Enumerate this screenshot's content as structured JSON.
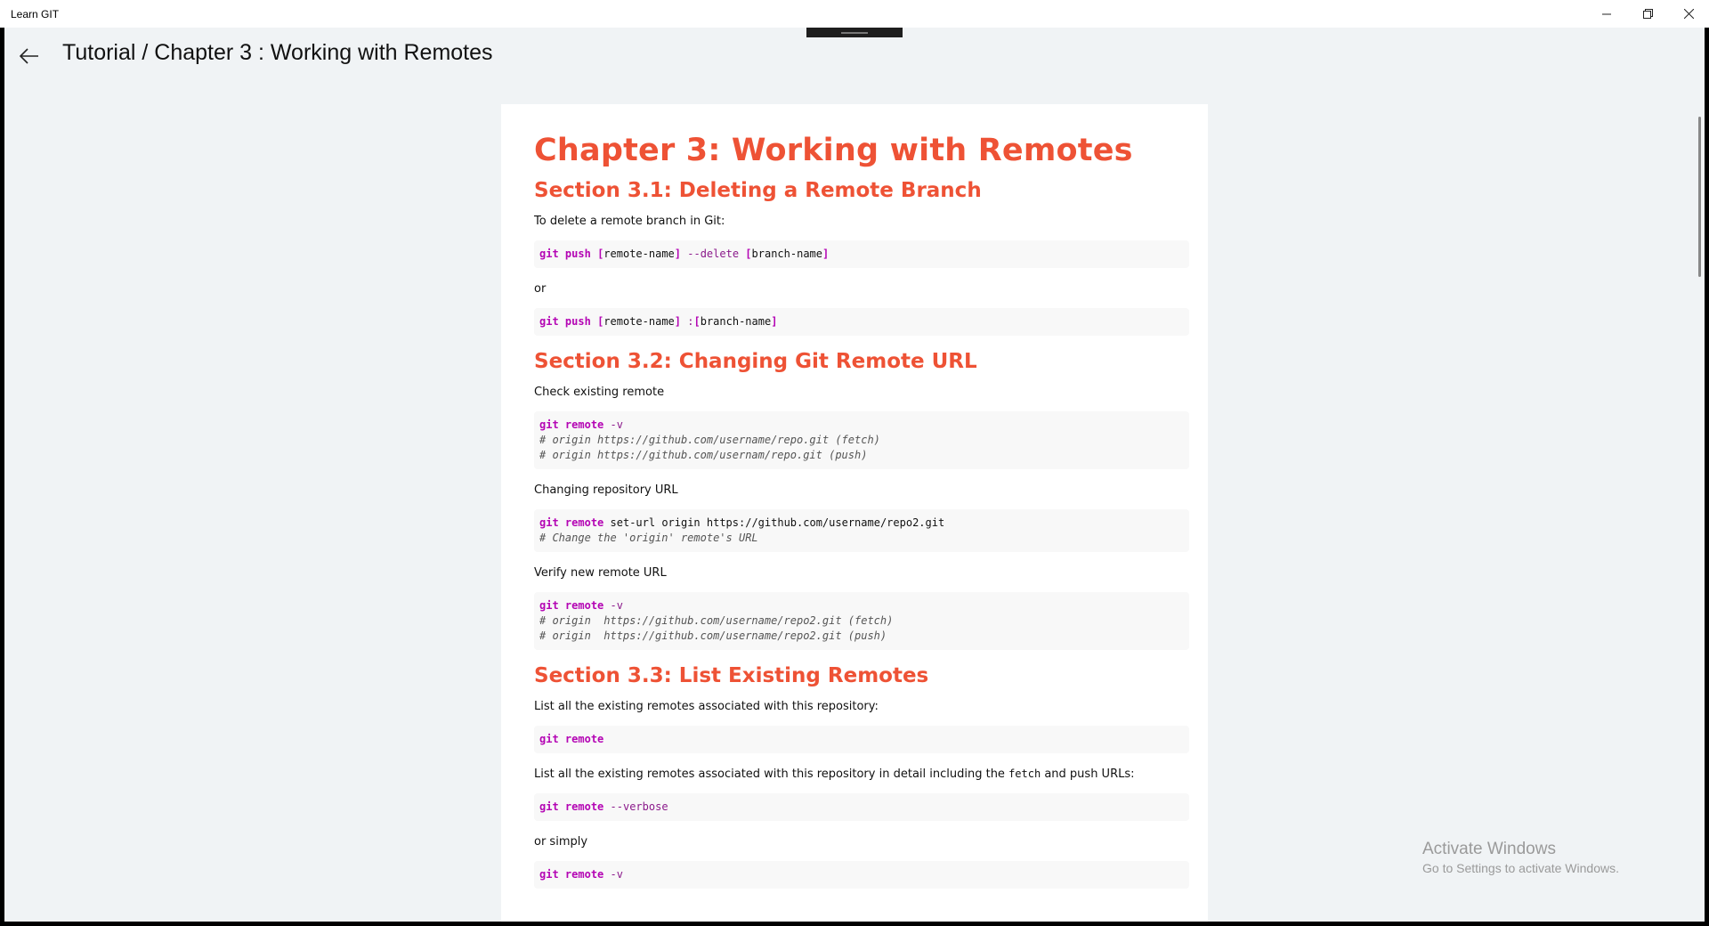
{
  "app": {
    "title": "Learn GIT"
  },
  "header": {
    "breadcrumb": "Tutorial / Chapter 3 :  Working with Remotes"
  },
  "doc": {
    "title": "Chapter 3: Working with Remotes",
    "s1": {
      "heading": "Section 3.1: Deleting a Remote Branch",
      "intro": "To delete a remote branch in Git:",
      "cmd1": {
        "git": "git",
        "push": "push",
        "ob1": "[",
        "arg1": "remote-name",
        "cb1": "]",
        "flag": "--delete",
        "ob2": "[",
        "arg2": "branch-name",
        "cb2": "]"
      },
      "or": "or",
      "cmd2": {
        "git": "git",
        "push": "push",
        "ob1": "[",
        "arg1": "remote-name",
        "cb1": "]",
        "colon": ":",
        "ob2": "[",
        "arg2": "branch-name",
        "cb2": "]"
      }
    },
    "s2": {
      "heading": "Section 3.2: Changing Git Remote URL",
      "check": "Check existing remote",
      "code1": {
        "git": "git",
        "remote": "remote",
        "flag": "-v",
        "c1": "# origin https://github.com/username/repo.git (fetch)",
        "c2": "# origin https://github.com/usernam/repo.git (push)"
      },
      "changing": "Changing repository URL",
      "code2": {
        "git": "git",
        "remote": "remote",
        "rest": "set-url origin https://github.com/username/repo2.git",
        "c1": "# Change the 'origin' remote's URL"
      },
      "verify": "Verify new remote URL",
      "code3": {
        "git": "git",
        "remote": "remote",
        "flag": "-v",
        "c1": "# origin  https://github.com/username/repo2.git (fetch)",
        "c2": "# origin  https://github.com/username/repo2.git (push)"
      }
    },
    "s3": {
      "heading": "Section 3.3: List Existing Remotes",
      "list": "List all the existing remotes associated with this repository:",
      "code1": {
        "git": "git",
        "remote": "remote"
      },
      "detail_a": "List all the existing remotes associated with this repository in detail including the ",
      "detail_code": "fetch",
      "detail_b": " and push URLs:",
      "code2": {
        "git": "git",
        "remote": "remote",
        "flag": "--verbose"
      },
      "simply": "or simply",
      "code3": {
        "git": "git",
        "remote": "remote",
        "flag": "-v"
      }
    }
  },
  "watermark": {
    "title": "Activate Windows",
    "sub": "Go to Settings to activate Windows."
  }
}
